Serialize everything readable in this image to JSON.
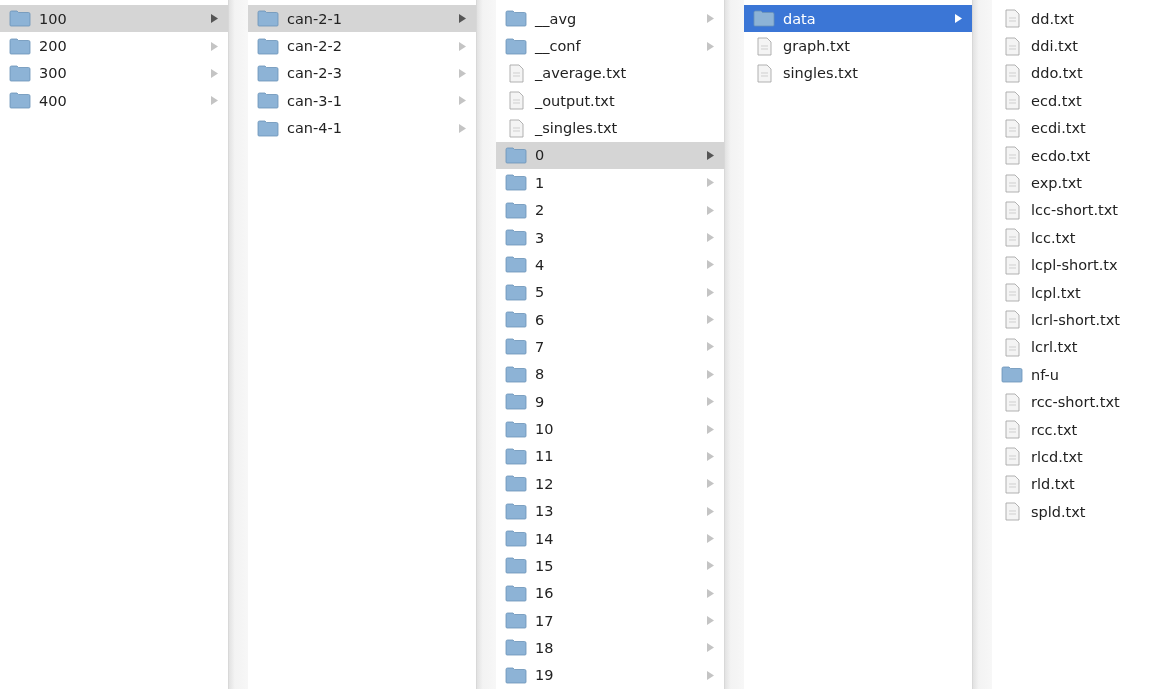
{
  "columns": [
    {
      "focused": false,
      "items": [
        {
          "name": "100",
          "kind": "folder",
          "expandable": true,
          "selected": true
        },
        {
          "name": "200",
          "kind": "folder",
          "expandable": true,
          "selected": false
        },
        {
          "name": "300",
          "kind": "folder",
          "expandable": true,
          "selected": false
        },
        {
          "name": "400",
          "kind": "folder",
          "expandable": true,
          "selected": false
        }
      ]
    },
    {
      "focused": false,
      "items": [
        {
          "name": "can-2-1",
          "kind": "folder",
          "expandable": true,
          "selected": true
        },
        {
          "name": "can-2-2",
          "kind": "folder",
          "expandable": true,
          "selected": false
        },
        {
          "name": "can-2-3",
          "kind": "folder",
          "expandable": true,
          "selected": false
        },
        {
          "name": "can-3-1",
          "kind": "folder",
          "expandable": true,
          "selected": false
        },
        {
          "name": "can-4-1",
          "kind": "folder",
          "expandable": true,
          "selected": false
        }
      ]
    },
    {
      "focused": false,
      "items": [
        {
          "name": "__avg",
          "kind": "folder",
          "expandable": true,
          "selected": false
        },
        {
          "name": "__conf",
          "kind": "folder",
          "expandable": true,
          "selected": false
        },
        {
          "name": "_average.txt",
          "kind": "file",
          "expandable": false,
          "selected": false
        },
        {
          "name": "_output.txt",
          "kind": "file",
          "expandable": false,
          "selected": false
        },
        {
          "name": "_singles.txt",
          "kind": "file",
          "expandable": false,
          "selected": false
        },
        {
          "name": "0",
          "kind": "folder",
          "expandable": true,
          "selected": true
        },
        {
          "name": "1",
          "kind": "folder",
          "expandable": true,
          "selected": false
        },
        {
          "name": "2",
          "kind": "folder",
          "expandable": true,
          "selected": false
        },
        {
          "name": "3",
          "kind": "folder",
          "expandable": true,
          "selected": false
        },
        {
          "name": "4",
          "kind": "folder",
          "expandable": true,
          "selected": false
        },
        {
          "name": "5",
          "kind": "folder",
          "expandable": true,
          "selected": false
        },
        {
          "name": "6",
          "kind": "folder",
          "expandable": true,
          "selected": false
        },
        {
          "name": "7",
          "kind": "folder",
          "expandable": true,
          "selected": false
        },
        {
          "name": "8",
          "kind": "folder",
          "expandable": true,
          "selected": false
        },
        {
          "name": "9",
          "kind": "folder",
          "expandable": true,
          "selected": false
        },
        {
          "name": "10",
          "kind": "folder",
          "expandable": true,
          "selected": false
        },
        {
          "name": "11",
          "kind": "folder",
          "expandable": true,
          "selected": false
        },
        {
          "name": "12",
          "kind": "folder",
          "expandable": true,
          "selected": false
        },
        {
          "name": "13",
          "kind": "folder",
          "expandable": true,
          "selected": false
        },
        {
          "name": "14",
          "kind": "folder",
          "expandable": true,
          "selected": false
        },
        {
          "name": "15",
          "kind": "folder",
          "expandable": true,
          "selected": false
        },
        {
          "name": "16",
          "kind": "folder",
          "expandable": true,
          "selected": false
        },
        {
          "name": "17",
          "kind": "folder",
          "expandable": true,
          "selected": false
        },
        {
          "name": "18",
          "kind": "folder",
          "expandable": true,
          "selected": false
        },
        {
          "name": "19",
          "kind": "folder",
          "expandable": true,
          "selected": false
        }
      ]
    },
    {
      "focused": true,
      "items": [
        {
          "name": "data",
          "kind": "folder",
          "expandable": true,
          "selected": true
        },
        {
          "name": "graph.txt",
          "kind": "file",
          "expandable": false,
          "selected": false
        },
        {
          "name": "singles.txt",
          "kind": "file",
          "expandable": false,
          "selected": false
        }
      ]
    },
    {
      "items": [
        {
          "name": "dd.txt",
          "kind": "file",
          "expandable": false,
          "selected": false
        },
        {
          "name": "ddi.txt",
          "kind": "file",
          "expandable": false,
          "selected": false
        },
        {
          "name": "ddo.txt",
          "kind": "file",
          "expandable": false,
          "selected": false
        },
        {
          "name": "ecd.txt",
          "kind": "file",
          "expandable": false,
          "selected": false
        },
        {
          "name": "ecdi.txt",
          "kind": "file",
          "expandable": false,
          "selected": false
        },
        {
          "name": "ecdo.txt",
          "kind": "file",
          "expandable": false,
          "selected": false
        },
        {
          "name": "exp.txt",
          "kind": "file",
          "expandable": false,
          "selected": false
        },
        {
          "name": "lcc-short.txt",
          "kind": "file",
          "expandable": false,
          "selected": false
        },
        {
          "name": "lcc.txt",
          "kind": "file",
          "expandable": false,
          "selected": false
        },
        {
          "name": "lcpl-short.tx",
          "kind": "file",
          "expandable": false,
          "selected": false
        },
        {
          "name": "lcpl.txt",
          "kind": "file",
          "expandable": false,
          "selected": false
        },
        {
          "name": "lcrl-short.txt",
          "kind": "file",
          "expandable": false,
          "selected": false
        },
        {
          "name": "lcrl.txt",
          "kind": "file",
          "expandable": false,
          "selected": false
        },
        {
          "name": "nf-u",
          "kind": "folder",
          "expandable": false,
          "selected": false
        },
        {
          "name": "rcc-short.txt",
          "kind": "file",
          "expandable": false,
          "selected": false
        },
        {
          "name": "rcc.txt",
          "kind": "file",
          "expandable": false,
          "selected": false
        },
        {
          "name": "rlcd.txt",
          "kind": "file",
          "expandable": false,
          "selected": false
        },
        {
          "name": "rld.txt",
          "kind": "file",
          "expandable": false,
          "selected": false
        },
        {
          "name": "spld.txt",
          "kind": "file",
          "expandable": false,
          "selected": false
        }
      ]
    }
  ]
}
